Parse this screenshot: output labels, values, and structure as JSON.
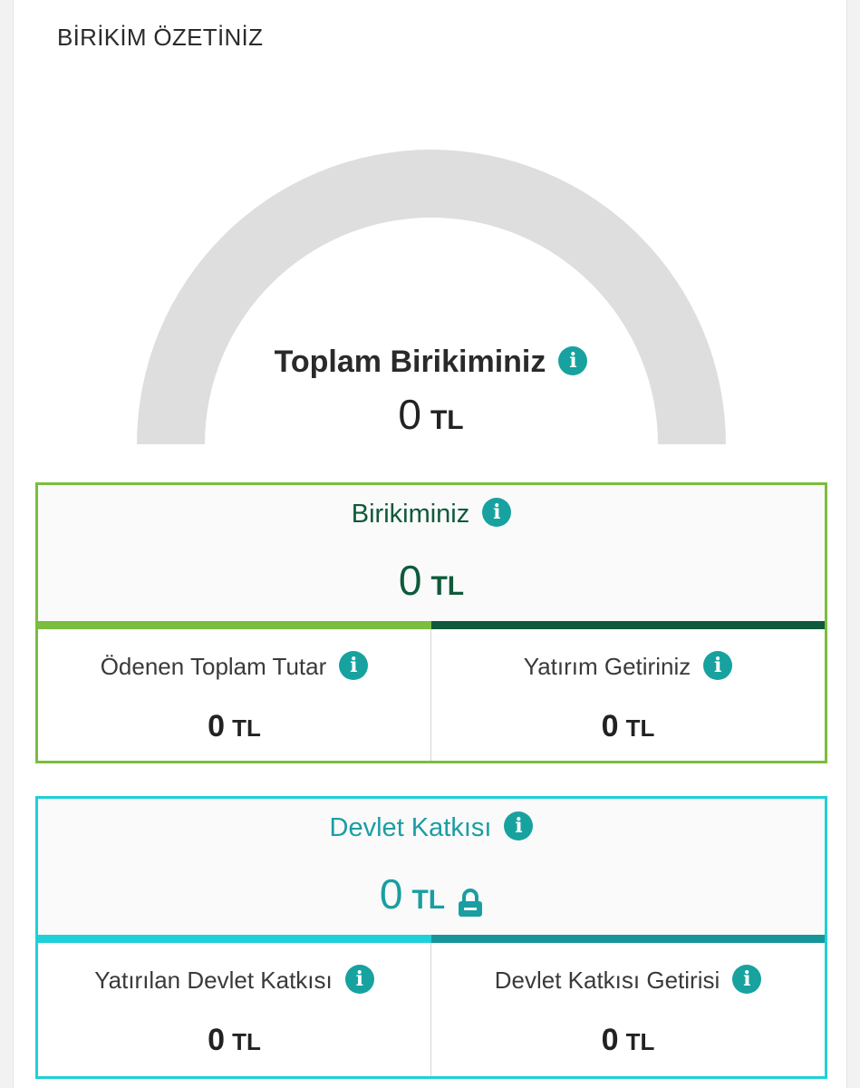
{
  "page": {
    "title": "BİRİKİM ÖZETİNİZ"
  },
  "total": {
    "label": "Toplam Birikiminiz",
    "value": "0",
    "unit": "TL",
    "gauge_fill": 0
  },
  "savings": {
    "title": "Birikiminiz",
    "value": "0",
    "unit": "TL",
    "paid": {
      "label": "Ödenen Toplam Tutar",
      "value": "0",
      "unit": "TL"
    },
    "returns": {
      "label": "Yatırım Getiriniz",
      "value": "0",
      "unit": "TL"
    }
  },
  "state": {
    "title": "Devlet Katkısı",
    "value": "0",
    "unit": "TL",
    "deposited": {
      "label": "Yatırılan Devlet Katkısı",
      "value": "0",
      "unit": "TL"
    },
    "returns": {
      "label": "Devlet Katkısı Getirisi",
      "value": "0",
      "unit": "TL"
    }
  },
  "icons": {
    "info": "info-icon",
    "lock": "lock-icon"
  },
  "colors": {
    "gauge_track": "#dedede",
    "info": "#17a2a0",
    "savings_border": "#7bbd3e",
    "savings_dark": "#0e5a3a",
    "state_border": "#1fd0d8",
    "state_dark": "#17959a"
  }
}
